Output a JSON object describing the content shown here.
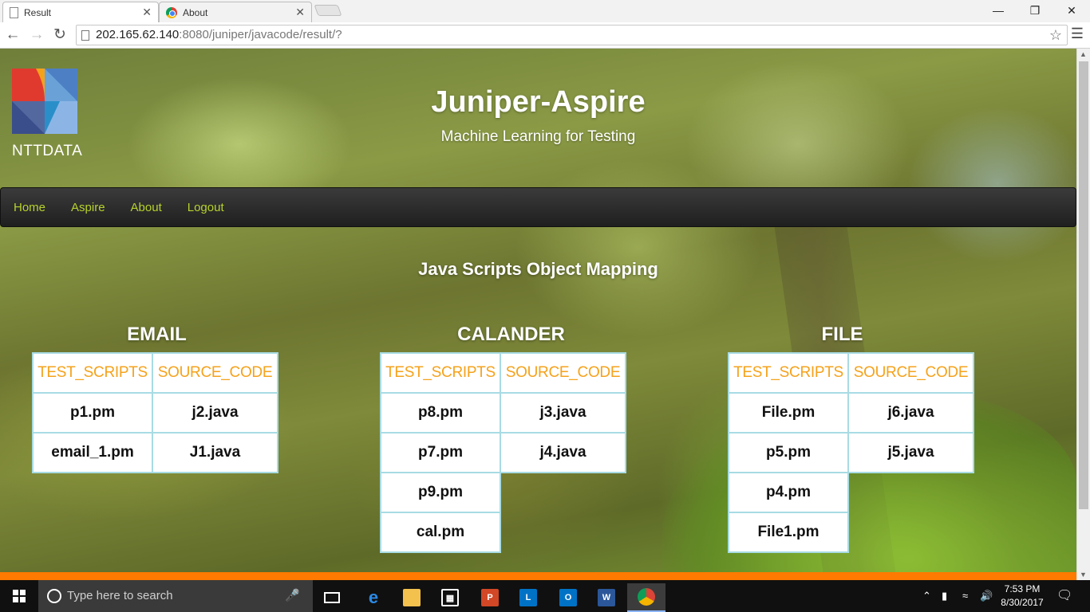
{
  "browser": {
    "tabs": [
      {
        "title": "Result",
        "active": true
      },
      {
        "title": "About",
        "active": false
      }
    ],
    "url_host": "202.165.62.140",
    "url_rest": ":8080/juniper/javacode/result/?"
  },
  "site": {
    "brand": "NTTDATA",
    "title": "Juniper-Aspire",
    "subtitle": "Machine Learning for Testing",
    "nav": [
      "Home",
      "Aspire",
      "About",
      "Logout"
    ]
  },
  "content": {
    "section_title": "Java Scripts Object Mapping",
    "groups": [
      {
        "title": "EMAIL",
        "headers": [
          "TEST_SCRIPTS",
          "SOURCE_CODE"
        ],
        "test_scripts": [
          "p1.pm",
          "email_1.pm"
        ],
        "source_code": [
          "j2.java",
          "J1.java"
        ]
      },
      {
        "title": "CALANDER",
        "headers": [
          "TEST_SCRIPTS",
          "SOURCE_CODE"
        ],
        "test_scripts": [
          "p8.pm",
          "p7.pm",
          "p9.pm",
          "cal.pm"
        ],
        "source_code": [
          "j3.java",
          "j4.java"
        ]
      },
      {
        "title": "FILE",
        "headers": [
          "TEST_SCRIPTS",
          "SOURCE_CODE"
        ],
        "test_scripts": [
          "File.pm",
          "p5.pm",
          "p4.pm",
          "File1.pm"
        ],
        "source_code": [
          "j6.java",
          "j5.java"
        ]
      }
    ]
  },
  "taskbar": {
    "search_placeholder": "Type here to search",
    "time": "7:53 PM",
    "date": "8/30/2017"
  },
  "colors": {
    "header_text": "#f5a21b",
    "nav_link": "#b6d22c",
    "table_border": "#a8dbe4",
    "footer_bar": "#ff7a00"
  }
}
